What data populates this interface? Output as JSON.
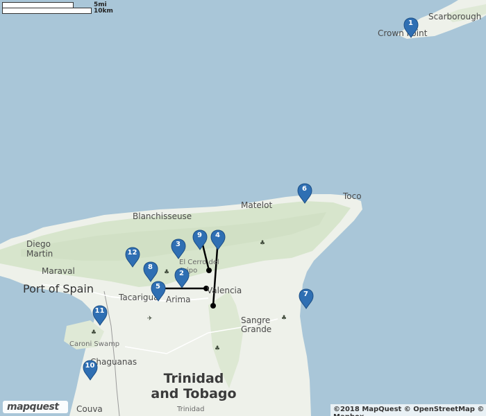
{
  "map": {
    "colors": {
      "water": "#a9c6d8",
      "land": "#eef1ea",
      "forest": "#d9e6cf",
      "route": "#000000",
      "marker": "#2f6fb3"
    },
    "scale": {
      "miles_label": "5mi",
      "km_label": "10km"
    },
    "labels": {
      "scarborough": "Scarborough",
      "crown_point": "Crown Point",
      "toco": "Toco",
      "matelot": "Matelot",
      "blanchisseuse": "Blanchisseuse",
      "diego_martin": "Diego\nMartin",
      "maraval": "Maraval",
      "port_of_spain": "Port of Spain",
      "tacarigua": "Tacarigua",
      "arima": "Arima",
      "valencia": "Valencia",
      "cerro_del_aripo": "El Cerro del\nAripo",
      "sangre_grande": "Sangre\nGrande",
      "caroni_swamp": "Caroni Swamp",
      "chaguanas": "Chaguanas",
      "country": "Trinidad\nand Tobago",
      "couva": "Couva",
      "trinidad": "Trinidad"
    },
    "markers": [
      "1",
      "2",
      "3",
      "4",
      "5",
      "6",
      "7",
      "8",
      "9",
      "10",
      "11",
      "12"
    ],
    "logo_text": "mapquest",
    "attribution": "©2018 MapQuest © OpenStreetMap © Mapbox"
  }
}
